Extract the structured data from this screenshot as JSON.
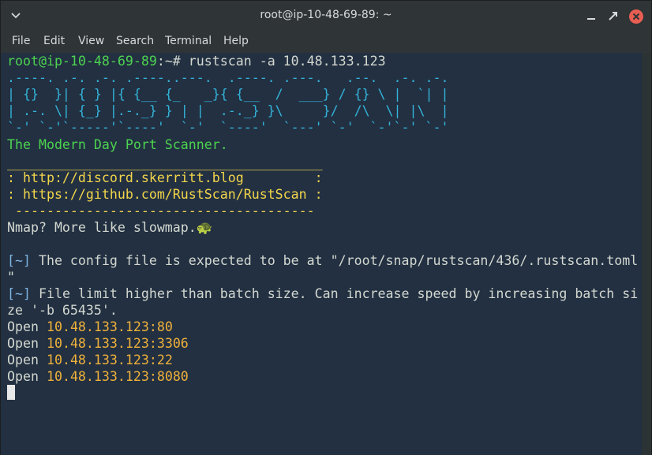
{
  "window": {
    "title": "root@ip-10-48-69-89: ~"
  },
  "menu": [
    "File",
    "Edit",
    "View",
    "Search",
    "Terminal",
    "Help"
  ],
  "terminal": {
    "prompt_user": "root@ip-10-48-69-89",
    "prompt_sep": ":~# ",
    "command": "rustscan -a 10.48.133.123",
    "banner": [
      ".----. .-. .-. .----..---.  .----. .---.   .--.  .-. .-.",
      "| {}  }| { } |{ {__ {_   _}{ {__  /  ___} / {} \\ |  `| |",
      "| .-. \\| {_} |.-._} } | |  .-._} }\\     }/  /\\  \\| |\\  |",
      "`-' `-'`-----'`----'  `-'  `----'  `---' `-'  `-'`-' `-'"
    ],
    "tagline": "The Modern Day Port Scanner.",
    "rule_top": "________________________________________",
    "link1": ": http://discord.skerritt.blog         :",
    "link2": ": https://github.com/RustScan/RustScan :",
    "rule_bottom": " --------------------------------------",
    "nmap": "Nmap? More like slowmap.",
    "turtle": "🐢",
    "info_tag": "[~]",
    "info1a": " The config file is expected to be at \"/root/snap/rustscan/436/.rustscan.toml",
    "info1b": "\"",
    "info2a": " File limit higher than batch size. Can increase speed by increasing batch si",
    "info2b": "ze '-b 65435'.",
    "open_label": "Open",
    "ports": [
      "10.48.133.123:80",
      "10.48.133.123:3306",
      "10.48.133.123:22",
      "10.48.133.123:8080"
    ]
  },
  "colors": {
    "background": "#223042",
    "prompt": "#4dd34f",
    "banner": "#34b3d8",
    "links": "#f2d54a",
    "info_tag": "#7fb4e0",
    "ip": "#f0b13a"
  }
}
